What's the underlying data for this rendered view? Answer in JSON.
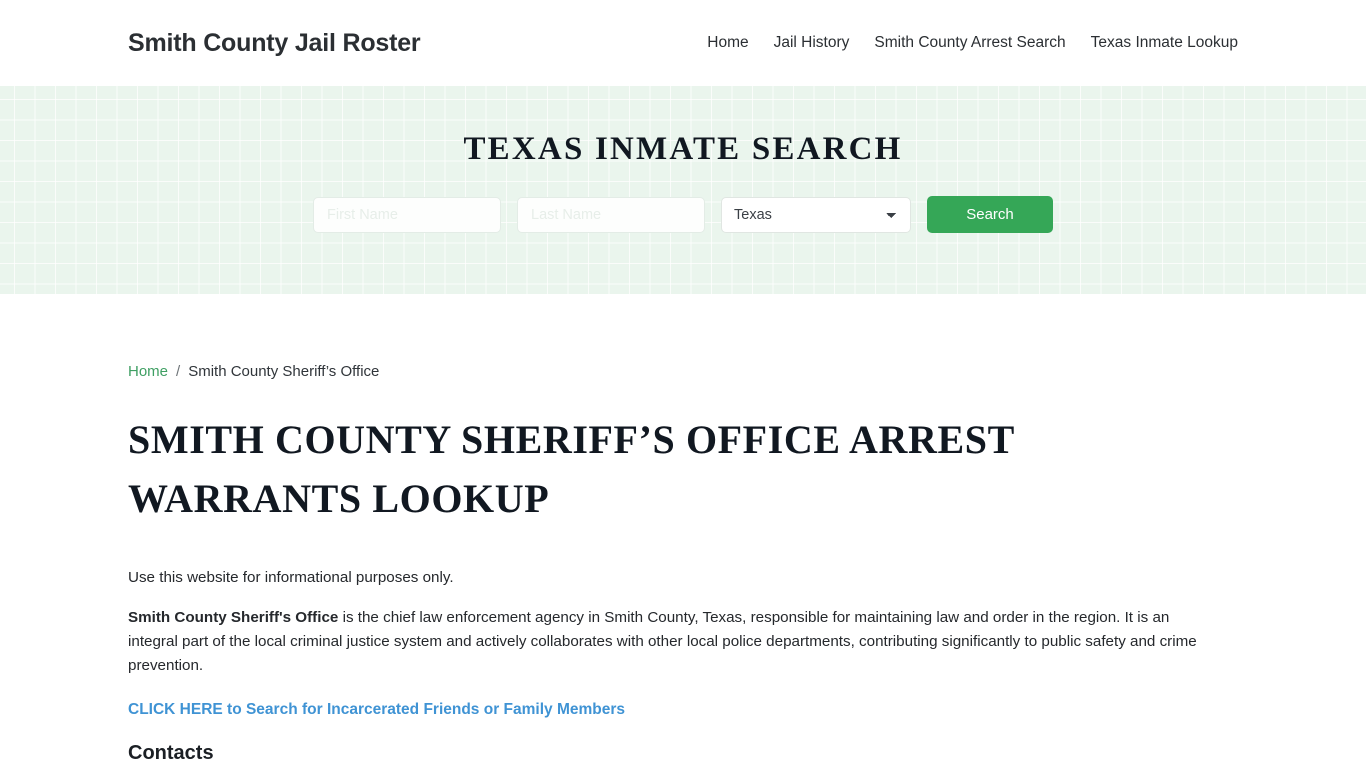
{
  "header": {
    "brand": "Smith County Jail Roster",
    "nav": [
      {
        "label": "Home"
      },
      {
        "label": "Jail History"
      },
      {
        "label": "Smith County Arrest Search"
      },
      {
        "label": "Texas Inmate Lookup"
      }
    ]
  },
  "hero": {
    "title": "TEXAS INMATE SEARCH",
    "first_name_placeholder": "First Name",
    "first_name_value": "",
    "last_name_placeholder": "Last Name",
    "last_name_value": "",
    "state_selected": "Texas",
    "state_options": [
      "Texas"
    ],
    "search_button": "Search",
    "accent_color": "#35a757",
    "background_color": "#eaf5ed"
  },
  "breadcrumb": {
    "home": "Home",
    "separator": "/",
    "current": "Smith County Sheriff’s Office"
  },
  "main": {
    "page_title": "SMITH COUNTY SHERIFF’S OFFICE ARREST WARRANTS LOOKUP",
    "disclaimer": "Use this website for informational purposes only.",
    "intro_bold": "Smith County Sheriff's Office",
    "intro_rest": " is the chief law enforcement agency in Smith County, Texas, responsible for maintaining law and order in the region. It is an integral part of the local criminal justice system and actively collaborates with other local police departments, contributing significantly to public safety and crime prevention.",
    "cta_link": "CLICK HERE to Search for Incarcerated Friends or Family Members",
    "cta_color": "#3f93d4",
    "contacts_heading": "Contacts"
  }
}
